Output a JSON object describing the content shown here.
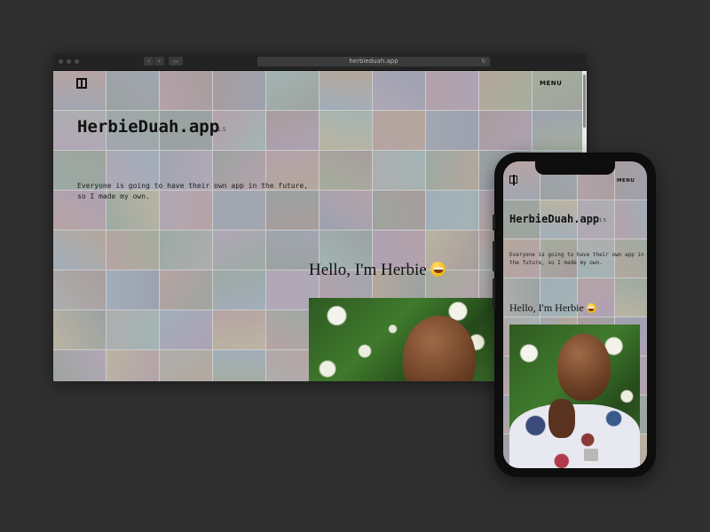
{
  "browser": {
    "url": "herbieduah.app",
    "nav_back_icon": "chevron-left-icon",
    "nav_forward_icon": "chevron-right-icon",
    "reload_icon": "reload-icon",
    "share_icon": "share-icon",
    "tabs_icon": "tabs-icon"
  },
  "site": {
    "logo": "logo-icon",
    "menu_label": "MENU",
    "title": "HerbieDuah.app",
    "version": "1.5",
    "tagline": "Everyone is going to have their own app in the future, so I made my own.",
    "greeting": "Hello, I'm Herbie",
    "greeting_emoji": "grinning-face-icon"
  },
  "colors": {
    "background": "#2f2f2f",
    "veil": "#ececec",
    "text": "#111111"
  }
}
